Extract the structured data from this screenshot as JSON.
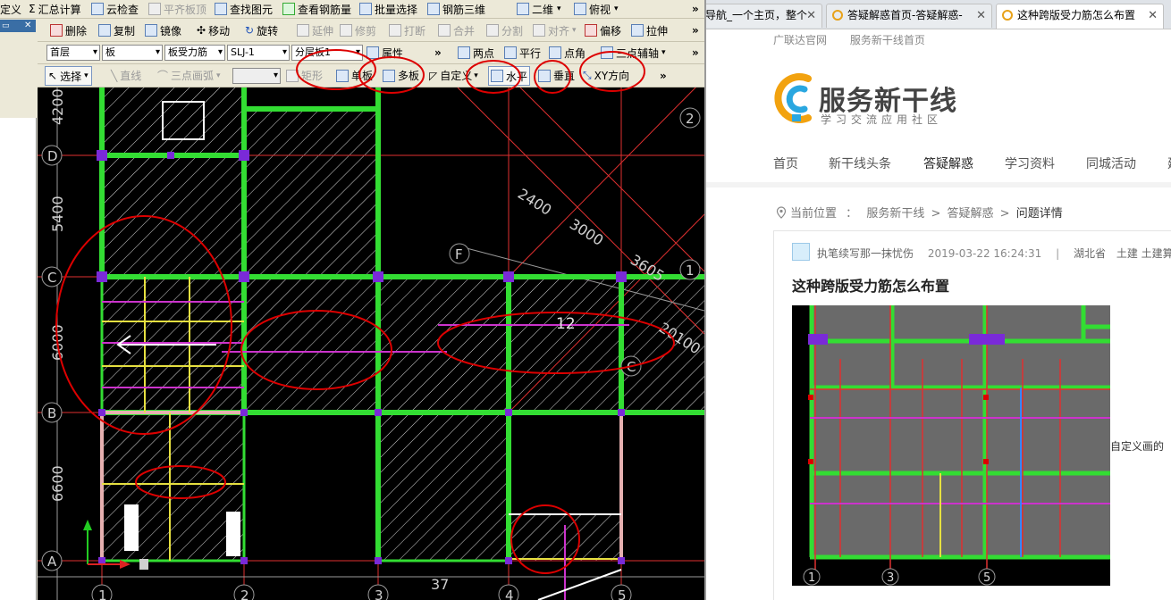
{
  "cad": {
    "menu": [
      "定义",
      "汇总计算",
      "云检查",
      "平齐板顶",
      "查找图元",
      "查看钢筋量",
      "批量选择",
      "钢筋三维",
      "二维",
      "俯视"
    ],
    "edit_toolbar": [
      "删除",
      "复制",
      "镜像",
      "移动",
      "旋转",
      "延伸",
      "修剪",
      "打断",
      "合并",
      "分割",
      "对齐",
      "偏移",
      "拉伸"
    ],
    "property_bar": {
      "floor": "首层",
      "type": "板",
      "subtype": "板受力筋",
      "element": "SLJ-1",
      "layer": "分层板1",
      "property_label": "属性",
      "draw_points": "两点",
      "draw_parallel": "平行",
      "draw_angle": "点角",
      "draw_axis": "三点辅轴"
    },
    "draw_toolbar": {
      "select": "选择",
      "line": "直线",
      "arc": "三点画弧",
      "rect": "矩形",
      "single": "单板",
      "multi": "多板",
      "custom": "自定义",
      "horizontal": "水平",
      "vertical": "垂直",
      "xy": "XY方向"
    },
    "drawing": {
      "row_axes": [
        "D",
        "C",
        "B",
        "A"
      ],
      "col_axes": [
        "1",
        "2",
        "3",
        "4",
        "5"
      ],
      "row_dims": [
        "4200",
        "5400",
        "6000",
        "6600"
      ],
      "col_dims": [
        "37"
      ],
      "oblique_axes": [
        "F",
        "2",
        "1",
        "C"
      ],
      "oblique_dims": [
        "2400",
        "3000",
        "3605",
        "20100"
      ],
      "marker": "12"
    }
  },
  "browser": {
    "tabs": [
      {
        "title": "导航_一个主页，整个"
      },
      {
        "title": "答疑解惑首页-答疑解惑-"
      },
      {
        "title": "这种跨版受力筋怎么布置"
      }
    ],
    "top_links": [
      "广联达官网",
      "服务新干线首页"
    ],
    "brand": {
      "name": "服务新干线",
      "slogan": "学习交流应用社区"
    },
    "main_nav": [
      "首页",
      "新干线头条",
      "答疑解惑",
      "学习资料",
      "同城活动",
      "建"
    ],
    "breadcrumb": {
      "label": "当前位置",
      "sep": "：",
      "items": [
        "服务新干线",
        "答疑解惑",
        "问题详情"
      ],
      "arrow": ">"
    },
    "post": {
      "author": "执笔续写那一抹忧伤",
      "date": "2019-03-22 16:24:31",
      "divider": "|",
      "region": "湖北省",
      "tags": "土建 土建算量",
      "title": "这种跨版受力筋怎么布置",
      "side_text": "自定义画的",
      "image_axes": [
        "1",
        "3",
        "5"
      ]
    }
  },
  "colors": {
    "beam_green": "#33dd33",
    "axis_red": "#e03030",
    "annotation_red": "#dd0000",
    "magenta": "#cc33cc",
    "yellow": "#e6e040",
    "purple": "#7a2ad8",
    "tab_favicon": "#e8a21a"
  }
}
